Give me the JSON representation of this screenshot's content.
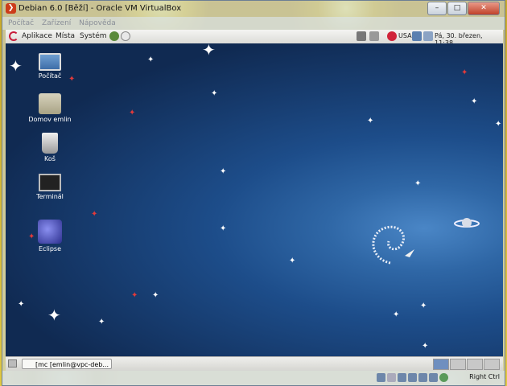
{
  "window": {
    "title": "Debian 6.0 [Běží] - Oracle VM VirtualBox",
    "menu": [
      "Počítač",
      "Zařízení",
      "Nápověda"
    ],
    "controls": [
      "minimize",
      "maximize",
      "close"
    ]
  },
  "gnome_panel": {
    "menus": [
      "Aplikace",
      "Místa",
      "Systém"
    ],
    "keyboard_layout": "USA",
    "clock": "Pá, 30. březen, 11:38"
  },
  "desktop": {
    "icons": [
      {
        "label": "Počítač",
        "icon": "computer-icon"
      },
      {
        "label": "Domov emlin",
        "icon": "home-folder-icon"
      },
      {
        "label": "Koš",
        "icon": "trash-icon"
      },
      {
        "label": "Terminál",
        "icon": "terminal-icon"
      },
      {
        "label": "Eclipse",
        "icon": "eclipse-icon"
      }
    ]
  },
  "taskbar": {
    "task_label": "[mc [emlin@vpc-deb...",
    "workspaces": 4,
    "active_workspace": 1
  },
  "vbox_status": {
    "host_key": "Right Ctrl"
  },
  "colors": {
    "desktop_blue": "#2f67a6",
    "close_red": "#c0412a"
  }
}
